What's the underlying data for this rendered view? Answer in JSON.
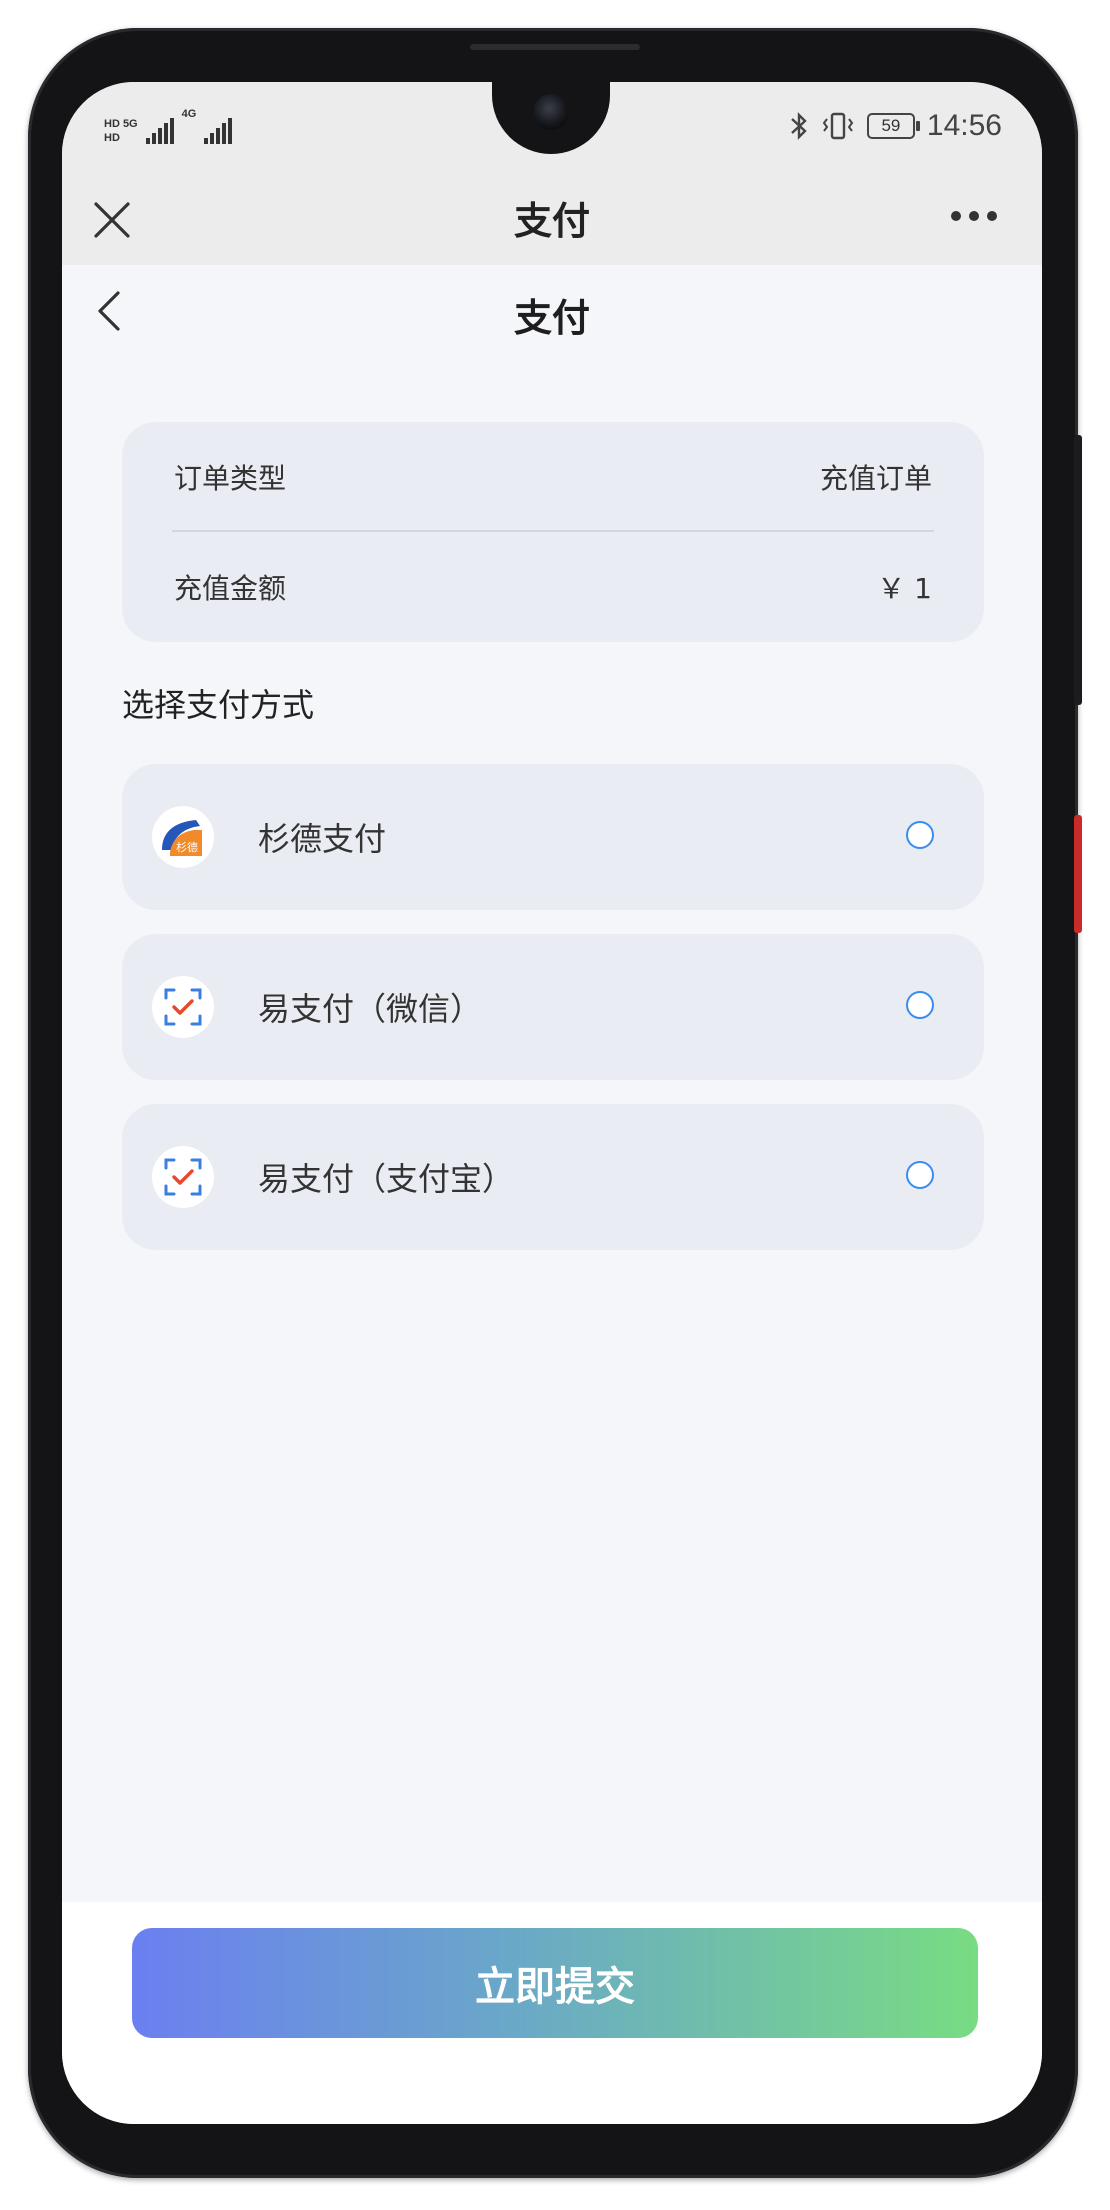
{
  "status_bar": {
    "time": "14:56",
    "battery": "59",
    "sim1_label": "HD 5G",
    "sim2_label": "4G"
  },
  "mini_program_bar": {
    "title": "支付"
  },
  "page": {
    "title": "支付"
  },
  "order": {
    "rows": [
      {
        "label": "订单类型",
        "value": "充值订单"
      },
      {
        "label": "充值金额",
        "value": "￥ 1"
      }
    ]
  },
  "payment": {
    "section_title": "选择支付方式",
    "methods": [
      {
        "name": "杉德支付",
        "icon": "sande-pay-logo",
        "selected": false
      },
      {
        "name": "易支付（微信）",
        "icon": "scan-check-icon",
        "selected": false
      },
      {
        "name": "易支付（支付宝）",
        "icon": "scan-check-icon",
        "selected": false
      }
    ]
  },
  "actions": {
    "submit_label": "立即提交"
  },
  "colors": {
    "accent_radio": "#3a8cf0",
    "button_gradient_start": "#6b7ff0",
    "button_gradient_end": "#78dc82",
    "card_bg": "#e9ecf2",
    "page_bg": "#f4f6fa"
  }
}
